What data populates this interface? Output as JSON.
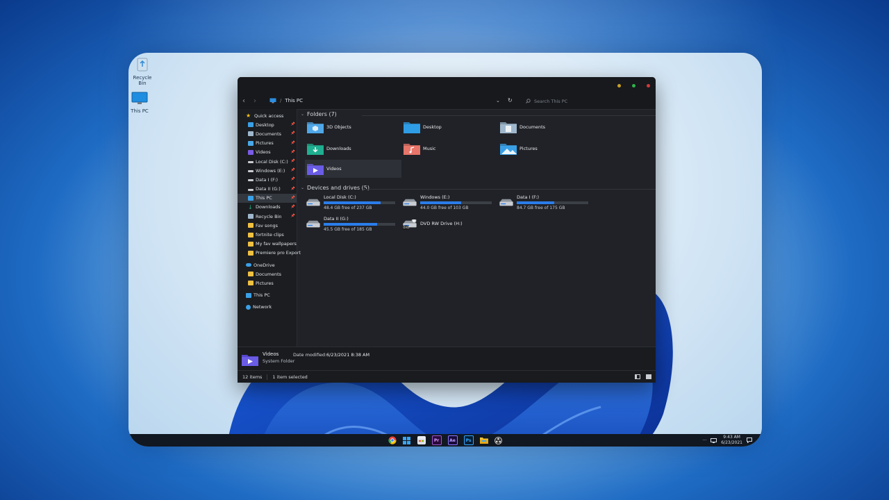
{
  "desktop": {
    "icons": [
      {
        "label": "Recycle Bin",
        "icon": "recycle-bin-icon"
      },
      {
        "label": "This PC",
        "icon": "monitor-icon"
      }
    ]
  },
  "explorer": {
    "breadcrumb": {
      "separator": "/",
      "location": "This PC"
    },
    "search_placeholder": "Search This PC",
    "window_controls": {
      "colors": [
        "#c9a227",
        "#2fb34a",
        "#d33a3a"
      ]
    },
    "sidebar": {
      "items": [
        {
          "label": "Quick access",
          "icon": "star-icon",
          "color": "#f3c11b",
          "pinned": false,
          "top": true
        },
        {
          "label": "Desktop",
          "icon": "desktop-folder-icon",
          "color": "#3aa0e6",
          "pinned": true
        },
        {
          "label": "Documents",
          "icon": "documents-folder-icon",
          "color": "#9fb7cc",
          "pinned": true
        },
        {
          "label": "Pictures",
          "icon": "pictures-folder-icon",
          "color": "#4aa8e8",
          "pinned": true
        },
        {
          "label": "Videos",
          "icon": "videos-folder-icon",
          "color": "#7a5ce6",
          "pinned": true
        },
        {
          "label": "Local Disk (C:)",
          "icon": "drive-icon",
          "color": "#c9ccd2",
          "pinned": true
        },
        {
          "label": "Windows (E:)",
          "icon": "drive-icon",
          "color": "#c9ccd2",
          "pinned": true
        },
        {
          "label": "Data I (F:)",
          "icon": "drive-icon",
          "color": "#c9ccd2",
          "pinned": true
        },
        {
          "label": "Data II (G:)",
          "icon": "drive-icon",
          "color": "#c9ccd2",
          "pinned": true
        },
        {
          "label": "This PC",
          "icon": "monitor-icon",
          "color": "#3aa0e6",
          "pinned": true,
          "selected": true
        },
        {
          "label": "Downloads",
          "icon": "download-icon",
          "color": "#27b07a",
          "pinned": true
        },
        {
          "label": "Recycle Bin",
          "icon": "recycle-bin-icon",
          "color": "#9fb7cc",
          "pinned": true
        },
        {
          "label": "Fav songs",
          "icon": "folder-icon",
          "color": "#f0c040",
          "pinned": false
        },
        {
          "label": "fortnite clips",
          "icon": "folder-icon",
          "color": "#f0c040",
          "pinned": false
        },
        {
          "label": "My fav wallpapers",
          "icon": "folder-icon",
          "color": "#f0c040",
          "pinned": false
        },
        {
          "label": "Premiere pro Export",
          "icon": "folder-icon",
          "color": "#f0c040",
          "pinned": false
        },
        {
          "label": "",
          "spacer": true
        },
        {
          "label": "OneDrive",
          "icon": "cloud-icon",
          "color": "#3aa0e6",
          "pinned": false,
          "top": true
        },
        {
          "label": "Documents",
          "icon": "folder-icon",
          "color": "#f0c040",
          "pinned": false
        },
        {
          "label": "Pictures",
          "icon": "folder-icon",
          "color": "#f0c040",
          "pinned": false
        },
        {
          "label": "",
          "spacer": true
        },
        {
          "label": "This PC",
          "icon": "monitor-icon",
          "color": "#3aa0e6",
          "pinned": false,
          "top": true
        },
        {
          "label": "",
          "spacer": true
        },
        {
          "label": "Network",
          "icon": "network-icon",
          "color": "#3aa0e6",
          "pinned": false,
          "top": true
        }
      ]
    },
    "folders_header": "Folders (7)",
    "folders": [
      {
        "label": "3D Objects",
        "icon": "3d-objects-folder-icon",
        "color": "#4fa7e8"
      },
      {
        "label": "Desktop",
        "icon": "desktop-folder-icon",
        "color": "#2f9de6"
      },
      {
        "label": "Documents",
        "icon": "documents-folder-icon",
        "color": "#9fb7cc"
      },
      {
        "label": "Downloads",
        "icon": "downloads-folder-icon",
        "color": "#1fae8f"
      },
      {
        "label": "Music",
        "icon": "music-folder-icon",
        "color": "#e8756a"
      },
      {
        "label": "Pictures",
        "icon": "pictures-folder-icon",
        "color": "#3aa0e6"
      },
      {
        "label": "Videos",
        "icon": "videos-folder-icon",
        "color": "#6a5ce6",
        "selected": true
      }
    ],
    "drives_header": "Devices and drives (5)",
    "drives": [
      {
        "label": "Local Disk (C:)",
        "free": "48.4 GB free of 237 GB",
        "used_fraction": 0.8,
        "icon": "system-drive-icon"
      },
      {
        "label": "Windows (E:)",
        "free": "44.0 GB free of 103 GB",
        "used_fraction": 0.57,
        "icon": "drive-icon"
      },
      {
        "label": "Data I (F:)",
        "free": "84.7 GB free of 175 GB",
        "used_fraction": 0.52,
        "icon": "drive-icon"
      },
      {
        "label": "Data II (G:)",
        "free": "45.5 GB free of 185 GB",
        "used_fraction": 0.75,
        "icon": "drive-icon"
      },
      {
        "label": "DVD RW Drive (H:)",
        "free": "",
        "used_fraction": null,
        "icon": "dvd-drive-icon",
        "badge": "DVD"
      }
    ],
    "details": {
      "name": "Videos",
      "type": "System Folder",
      "date_label": "Date modified:",
      "date_value": "6/23/2021 8:38 AM"
    },
    "status": {
      "count": "12 items",
      "selected": "1 item selected"
    }
  },
  "taskbar": {
    "apps": [
      {
        "name": "chrome-icon",
        "label": ""
      },
      {
        "name": "start-icon",
        "label": ""
      },
      {
        "name": "store-icon",
        "label": ""
      },
      {
        "name": "premiere-icon",
        "label": "Pr"
      },
      {
        "name": "after-effects-icon",
        "label": "Ae"
      },
      {
        "name": "photoshop-icon",
        "label": "Ps"
      },
      {
        "name": "file-explorer-icon",
        "label": ""
      },
      {
        "name": "obs-icon",
        "label": ""
      }
    ],
    "tray": {
      "time": "9:43 AM",
      "date": "6/23/2021"
    }
  }
}
